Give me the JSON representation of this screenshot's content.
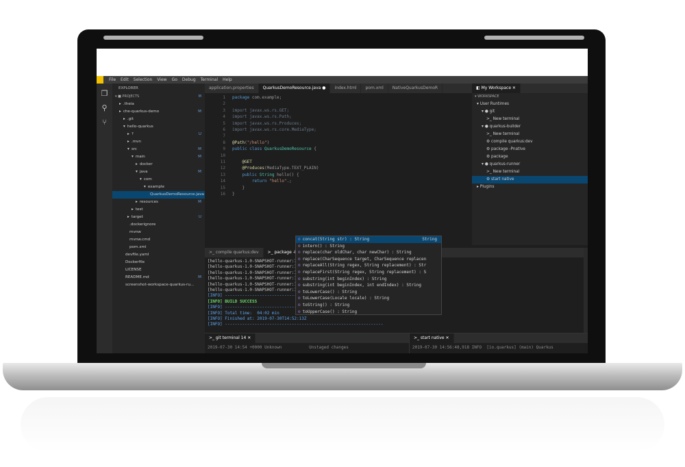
{
  "menu": [
    "File",
    "Edit",
    "Selection",
    "View",
    "Go",
    "Debug",
    "Terminal",
    "Help"
  ],
  "explorer": {
    "header": "EXPLORER",
    "section": "PROJECTS",
    "items": [
      {
        "label": ".theia",
        "indent": 1,
        "arrow": "▸",
        "git": ""
      },
      {
        "label": "che-quarkus-demo",
        "indent": 1,
        "arrow": "▸",
        "git": "M"
      },
      {
        "label": ".git",
        "indent": 2,
        "arrow": "▸",
        "git": ""
      },
      {
        "label": "hello-quarkus",
        "indent": 2,
        "arrow": "▾",
        "git": ""
      },
      {
        "label": "?",
        "indent": 3,
        "arrow": "▸",
        "git": "U"
      },
      {
        "label": ".mvn",
        "indent": 3,
        "arrow": "▸",
        "git": ""
      },
      {
        "label": "src",
        "indent": 3,
        "arrow": "▾",
        "git": "M"
      },
      {
        "label": "main",
        "indent": 4,
        "arrow": "▾",
        "git": "M"
      },
      {
        "label": "docker",
        "indent": 5,
        "arrow": "▸",
        "git": ""
      },
      {
        "label": "java",
        "indent": 5,
        "arrow": "▾",
        "git": "M"
      },
      {
        "label": "com",
        "indent": 6,
        "arrow": "▾",
        "git": ""
      },
      {
        "label": "example",
        "indent": 7,
        "arrow": "▾",
        "git": ""
      },
      {
        "label": "QuarkusDemoResource.java",
        "indent": 8,
        "arrow": "",
        "git": ""
      },
      {
        "label": "resources",
        "indent": 5,
        "arrow": "▸",
        "git": "M"
      },
      {
        "label": "test",
        "indent": 4,
        "arrow": "▸",
        "git": ""
      },
      {
        "label": "target",
        "indent": 3,
        "arrow": "▸",
        "git": "U"
      },
      {
        "label": ".dockerignore",
        "indent": 3,
        "arrow": "",
        "git": ""
      },
      {
        "label": "mvnw",
        "indent": 3,
        "arrow": "",
        "git": ""
      },
      {
        "label": "mvnw.cmd",
        "indent": 3,
        "arrow": "",
        "git": ""
      },
      {
        "label": "pom.xml",
        "indent": 3,
        "arrow": "",
        "git": ""
      },
      {
        "label": "devfile.yaml",
        "indent": 2,
        "arrow": "",
        "git": ""
      },
      {
        "label": "Dockerfile",
        "indent": 2,
        "arrow": "",
        "git": ""
      },
      {
        "label": "LICENSE",
        "indent": 2,
        "arrow": "",
        "git": ""
      },
      {
        "label": "README.md",
        "indent": 2,
        "arrow": "",
        "git": "M"
      },
      {
        "label": "screenshot-workspace-quarkus-ru...",
        "indent": 2,
        "arrow": "",
        "git": ""
      }
    ]
  },
  "editor": {
    "tabs": [
      "application.properties",
      "QuarkusDemoResource.java ●",
      "index.html",
      "pom.xml",
      "NativeQuarkusDemoR"
    ],
    "lines": [
      "1",
      "2",
      "3",
      "4",
      "5",
      "6",
      "7",
      "8",
      "9",
      "10",
      "11",
      "12",
      "13",
      "14",
      "15",
      "16"
    ],
    "suggestions": [
      {
        "label": "concat(String str) : String",
        "ret": "String"
      },
      {
        "label": "intern() : String",
        "ret": ""
      },
      {
        "label": "replace(char oldChar, char newChar) : String",
        "ret": ""
      },
      {
        "label": "replace(CharSequence target, CharSequence replacen",
        "ret": ""
      },
      {
        "label": "replaceAll(String regex, String replacement) : Str",
        "ret": ""
      },
      {
        "label": "replaceFirst(String regex, String replacement) : S",
        "ret": ""
      },
      {
        "label": "substring(int beginIndex) : String",
        "ret": ""
      },
      {
        "label": "substring(int beginIndex, int endIndex) : String",
        "ret": ""
      },
      {
        "label": "toLowerCase() : String",
        "ret": ""
      },
      {
        "label": "toLowerCase(Locale locale) : String",
        "ret": ""
      },
      {
        "label": "toString() : String",
        "ret": ""
      },
      {
        "label": "toUpperCase() : String",
        "ret": ""
      }
    ]
  },
  "workspace": {
    "tab": "My Workspace",
    "section": "WORKSPACE",
    "items": [
      {
        "label": "▾ User Runtimes",
        "indent": 1
      },
      {
        "label": "▾ ● git",
        "indent": 2
      },
      {
        "label": ">_ New terminal",
        "indent": 3
      },
      {
        "label": "▾ ● quarkus-builder",
        "indent": 2
      },
      {
        "label": ">_ New terminal",
        "indent": 3
      },
      {
        "label": "⚙ compile quarkus:dev",
        "indent": 3
      },
      {
        "label": "⚙ package -Pnative",
        "indent": 3
      },
      {
        "label": "⚙ package",
        "indent": 3
      },
      {
        "label": "▾ ● quarkus-runner",
        "indent": 2
      },
      {
        "label": ">_ New terminal",
        "indent": 3
      },
      {
        "label": "⚙ start native",
        "indent": 3
      },
      {
        "label": "▸ Plugins",
        "indent": 1
      }
    ]
  },
  "terminal": {
    "tabs": [
      ">_ compile quarkus:dev",
      ">_ package -P"
    ],
    "lines": [
      "[hello-quarkus-1.0-SNAPSHOT-runner:1124]",
      "[hello-quarkus-1.0-SNAPSHOT-runner:1124]     (compile):  72,994.25 ms",
      "[hello-quarkus-1.0-SNAPSHOT-runner:1124]       compile: 106,000.31 ms",
      "[hello-quarkus-1.0-SNAPSHOT-runner:1124]         image:   3,586.62 ms",
      "[hello-quarkus-1.0-SNAPSHOT-runner:1124]         write:     562.33 ms",
      "[hello-quarkus-1.0-SNAPSHOT-runner:1124]       [total]: 212,931.14 ms",
      "[INFO] ----------------------------------------------------------------",
      "[INFO] BUILD SUCCESS",
      "[INFO] ----------------------------------------------------------------",
      "[INFO] Total time:  04:02 min",
      "[INFO] Finished at: 2019-07-30T14:52:13Z",
      "[INFO] ----------------------------------------------------------------"
    ]
  },
  "git_terminal": {
    "tab": ">_ git terminal 14",
    "line": "2019-07-30 14:54 +0000 Unknown           Unstaged changes"
  },
  "native_terminal": {
    "tab": ">_ start native",
    "line": "2019-07-30 14:56:48,918 INFO  [io.quarkus] (main) Quarkus"
  }
}
